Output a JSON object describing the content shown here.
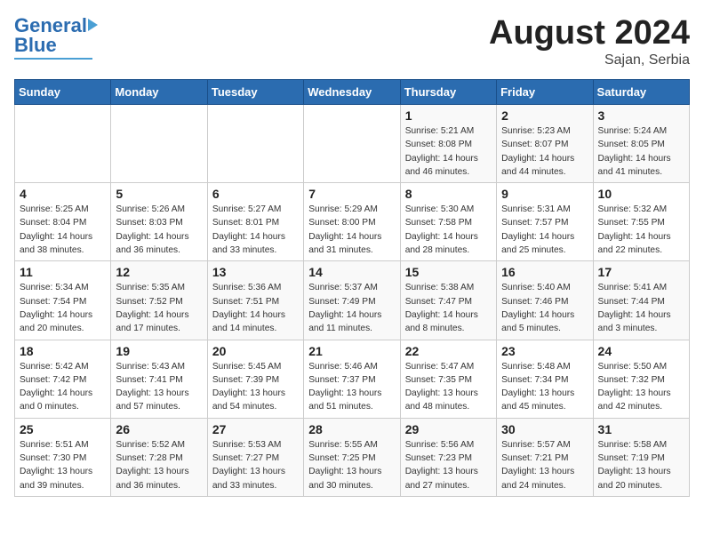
{
  "header": {
    "logo_general": "General",
    "logo_blue": "Blue",
    "month_title": "August 2024",
    "location": "Sajan, Serbia"
  },
  "days_of_week": [
    "Sunday",
    "Monday",
    "Tuesday",
    "Wednesday",
    "Thursday",
    "Friday",
    "Saturday"
  ],
  "weeks": [
    [
      {
        "day": "",
        "info": ""
      },
      {
        "day": "",
        "info": ""
      },
      {
        "day": "",
        "info": ""
      },
      {
        "day": "",
        "info": ""
      },
      {
        "day": "1",
        "info": "Sunrise: 5:21 AM\nSunset: 8:08 PM\nDaylight: 14 hours\nand 46 minutes."
      },
      {
        "day": "2",
        "info": "Sunrise: 5:23 AM\nSunset: 8:07 PM\nDaylight: 14 hours\nand 44 minutes."
      },
      {
        "day": "3",
        "info": "Sunrise: 5:24 AM\nSunset: 8:05 PM\nDaylight: 14 hours\nand 41 minutes."
      }
    ],
    [
      {
        "day": "4",
        "info": "Sunrise: 5:25 AM\nSunset: 8:04 PM\nDaylight: 14 hours\nand 38 minutes."
      },
      {
        "day": "5",
        "info": "Sunrise: 5:26 AM\nSunset: 8:03 PM\nDaylight: 14 hours\nand 36 minutes."
      },
      {
        "day": "6",
        "info": "Sunrise: 5:27 AM\nSunset: 8:01 PM\nDaylight: 14 hours\nand 33 minutes."
      },
      {
        "day": "7",
        "info": "Sunrise: 5:29 AM\nSunset: 8:00 PM\nDaylight: 14 hours\nand 31 minutes."
      },
      {
        "day": "8",
        "info": "Sunrise: 5:30 AM\nSunset: 7:58 PM\nDaylight: 14 hours\nand 28 minutes."
      },
      {
        "day": "9",
        "info": "Sunrise: 5:31 AM\nSunset: 7:57 PM\nDaylight: 14 hours\nand 25 minutes."
      },
      {
        "day": "10",
        "info": "Sunrise: 5:32 AM\nSunset: 7:55 PM\nDaylight: 14 hours\nand 22 minutes."
      }
    ],
    [
      {
        "day": "11",
        "info": "Sunrise: 5:34 AM\nSunset: 7:54 PM\nDaylight: 14 hours\nand 20 minutes."
      },
      {
        "day": "12",
        "info": "Sunrise: 5:35 AM\nSunset: 7:52 PM\nDaylight: 14 hours\nand 17 minutes."
      },
      {
        "day": "13",
        "info": "Sunrise: 5:36 AM\nSunset: 7:51 PM\nDaylight: 14 hours\nand 14 minutes."
      },
      {
        "day": "14",
        "info": "Sunrise: 5:37 AM\nSunset: 7:49 PM\nDaylight: 14 hours\nand 11 minutes."
      },
      {
        "day": "15",
        "info": "Sunrise: 5:38 AM\nSunset: 7:47 PM\nDaylight: 14 hours\nand 8 minutes."
      },
      {
        "day": "16",
        "info": "Sunrise: 5:40 AM\nSunset: 7:46 PM\nDaylight: 14 hours\nand 5 minutes."
      },
      {
        "day": "17",
        "info": "Sunrise: 5:41 AM\nSunset: 7:44 PM\nDaylight: 14 hours\nand 3 minutes."
      }
    ],
    [
      {
        "day": "18",
        "info": "Sunrise: 5:42 AM\nSunset: 7:42 PM\nDaylight: 14 hours\nand 0 minutes."
      },
      {
        "day": "19",
        "info": "Sunrise: 5:43 AM\nSunset: 7:41 PM\nDaylight: 13 hours\nand 57 minutes."
      },
      {
        "day": "20",
        "info": "Sunrise: 5:45 AM\nSunset: 7:39 PM\nDaylight: 13 hours\nand 54 minutes."
      },
      {
        "day": "21",
        "info": "Sunrise: 5:46 AM\nSunset: 7:37 PM\nDaylight: 13 hours\nand 51 minutes."
      },
      {
        "day": "22",
        "info": "Sunrise: 5:47 AM\nSunset: 7:35 PM\nDaylight: 13 hours\nand 48 minutes."
      },
      {
        "day": "23",
        "info": "Sunrise: 5:48 AM\nSunset: 7:34 PM\nDaylight: 13 hours\nand 45 minutes."
      },
      {
        "day": "24",
        "info": "Sunrise: 5:50 AM\nSunset: 7:32 PM\nDaylight: 13 hours\nand 42 minutes."
      }
    ],
    [
      {
        "day": "25",
        "info": "Sunrise: 5:51 AM\nSunset: 7:30 PM\nDaylight: 13 hours\nand 39 minutes."
      },
      {
        "day": "26",
        "info": "Sunrise: 5:52 AM\nSunset: 7:28 PM\nDaylight: 13 hours\nand 36 minutes."
      },
      {
        "day": "27",
        "info": "Sunrise: 5:53 AM\nSunset: 7:27 PM\nDaylight: 13 hours\nand 33 minutes."
      },
      {
        "day": "28",
        "info": "Sunrise: 5:55 AM\nSunset: 7:25 PM\nDaylight: 13 hours\nand 30 minutes."
      },
      {
        "day": "29",
        "info": "Sunrise: 5:56 AM\nSunset: 7:23 PM\nDaylight: 13 hours\nand 27 minutes."
      },
      {
        "day": "30",
        "info": "Sunrise: 5:57 AM\nSunset: 7:21 PM\nDaylight: 13 hours\nand 24 minutes."
      },
      {
        "day": "31",
        "info": "Sunrise: 5:58 AM\nSunset: 7:19 PM\nDaylight: 13 hours\nand 20 minutes."
      }
    ]
  ]
}
